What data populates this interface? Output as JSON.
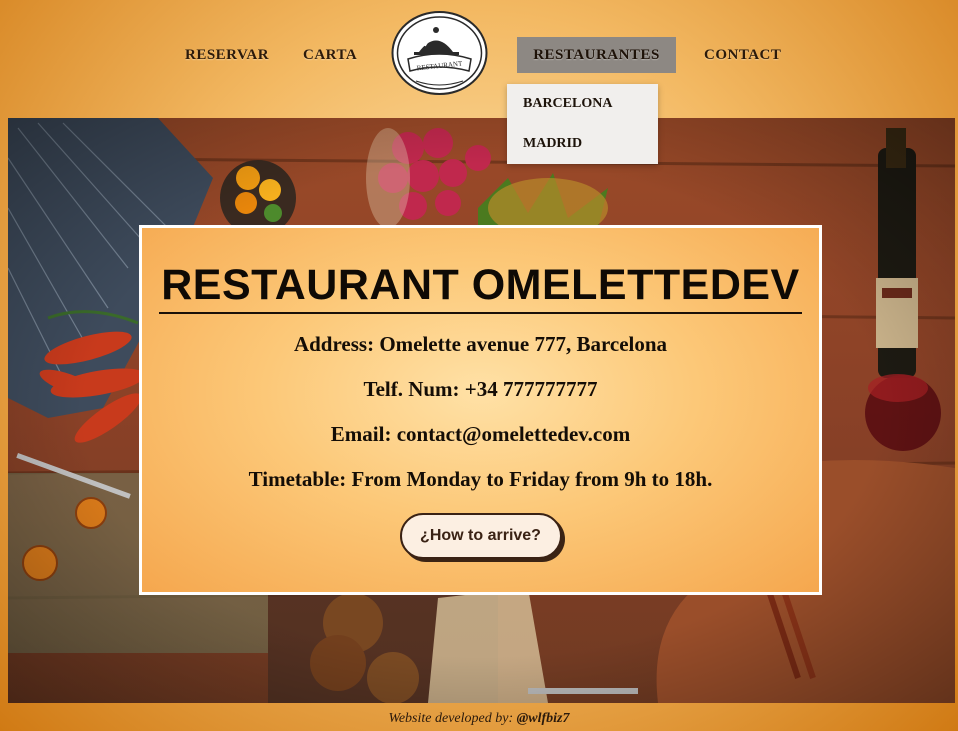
{
  "nav": {
    "links": [
      {
        "label": "RESERVAR"
      },
      {
        "label": "CARTA"
      },
      {
        "label": "RESTAURANTES"
      },
      {
        "label": "CONTACT"
      }
    ],
    "logo_text": "RESTAURANT",
    "dropdown": [
      "BARCELONA",
      "MADRID"
    ]
  },
  "card": {
    "title": "RESTAURANT OMELETTEDEV",
    "address": "Address: Omelette avenue 777, Barcelona",
    "phone": "Telf. Num: +34 777777777",
    "email": "Email: contact@omelettedev.com",
    "timetable": "Timetable: From Monday to Friday from 9h to 18h.",
    "button": "¿How to arrive?"
  },
  "footer": {
    "prefix": "Website developed by:",
    "author": "@wlfbiz7"
  },
  "colors": {
    "accent_orange": "#d07a14",
    "active_nav_bg": "#8d8883",
    "card_border": "#ffffff"
  }
}
